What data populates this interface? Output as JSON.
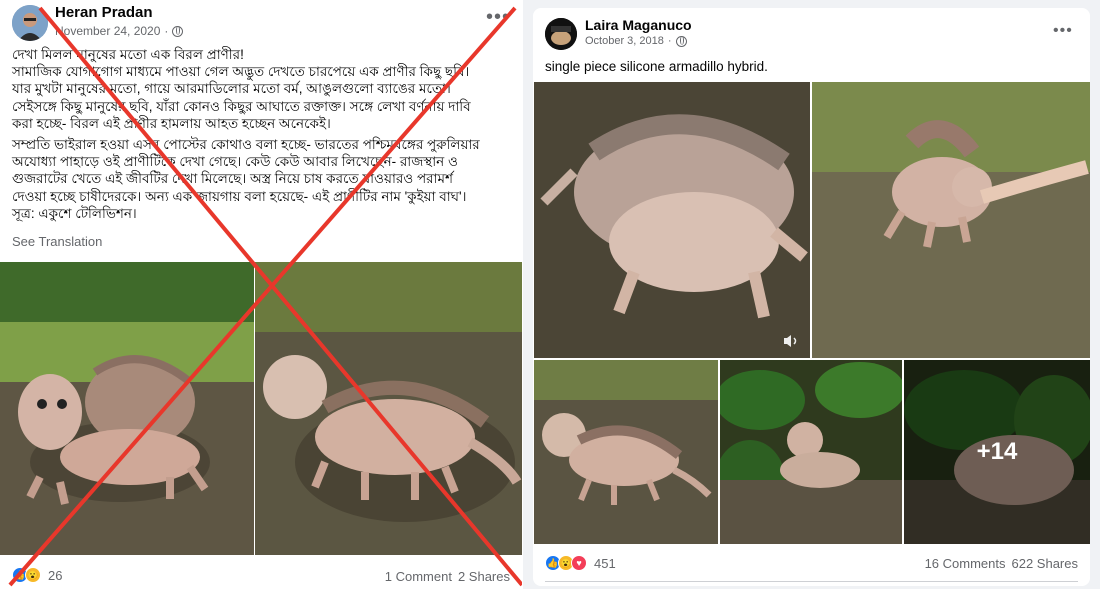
{
  "left_post": {
    "author": "Heran Pradan",
    "date": "November 24, 2020",
    "more_icon": "more-horizontal-icon",
    "paragraph_1_lines": [
      "দেখা মিলল মানুষের মতো এক বিরল প্রাণীর!",
      "সামাজিক যোগাগোগ মাধ্যমে পাওয়া গেল অদ্ভুত দেখতে চারপেয়ে এক প্রাণীর কিছু ছবি।",
      "যার মুখটা মানুষের মতো, গায়ে আরমাডিলোর মতো বর্ম, আঙুলগুলো ব্যাঙের মতো।",
      "সেইসঙ্গে কিছু মানুষের ছবি, যাঁরা কোনও কিছুর আঘাতে রক্তাক্ত। সঙ্গে লেখা বর্ণনায় দাবি",
      "করা হচ্ছে- বিরল এই প্রাণীর হামলায় আহত হচ্ছেন অনেকেই।"
    ],
    "paragraph_2_lines": [
      "সম্প্রতি ভাইরাল হওয়া এসব পোস্টের কোথাও বলা হচ্ছে- ভারতের পশ্চিমবঙ্গের পুরুলিয়ার",
      "অযোধ্যা পাহাড়ে ওই প্রাণীটিকে দেখা গেছে। কেউ কেউ আবার লিখেছেন- রাজস্থান ও",
      "গুজরাটের খেতে এই জীবটির দেখা মিলেছে। অস্ত্র নিয়ে চাষ করতে যাওয়ারও পরামর্শ",
      "দেওয়া হচ্ছে চাষীদেরকে। অন্য এক জায়গায় বলা হয়েছে- এই প্রাণীটির নাম 'কুইয়া বাঘ'।",
      "সূত্র: একুশে টেলিভিশন।"
    ],
    "see_translation": "See Translation",
    "reaction_count": "26",
    "comments": "1 Comment",
    "shares": "2 Shares"
  },
  "right_post": {
    "author": "Laira Maganuco",
    "date": "October 3, 2018",
    "more_icon": "more-horizontal-icon",
    "caption": "single piece silicone armadillo hybrid.",
    "more_photos": "+14",
    "reaction_count": "451",
    "comments": "16 Comments",
    "shares": "622 Shares"
  },
  "colors": {
    "cross": "#e8372b",
    "link": "#65676b",
    "like": "#1877f2"
  }
}
